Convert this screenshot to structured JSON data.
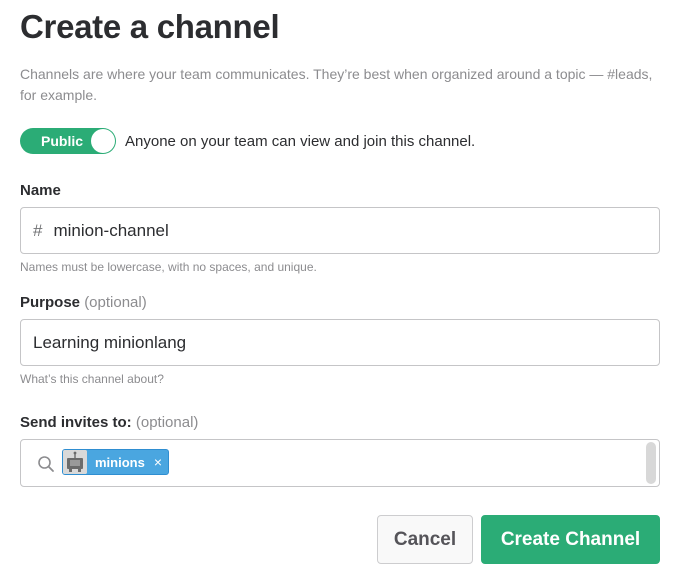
{
  "header": {
    "title": "Create a channel",
    "description": "Channels are where your team communicates. They’re best when organized around a topic — #leads, for example."
  },
  "visibility": {
    "toggle_label": "Public",
    "toggle_on": true,
    "description": "Anyone on your team can view and join this channel.",
    "accent_color": "#2bac76"
  },
  "name_field": {
    "label": "Name",
    "prefix": "#",
    "value": "minion-channel",
    "hint": "Names must be lowercase, with no spaces, and unique."
  },
  "purpose_field": {
    "label": "Purpose",
    "optional": "(optional)",
    "value": "Learning minionlang",
    "hint": "What’s this channel about?"
  },
  "invites_field": {
    "label": "Send invites to:",
    "optional": "(optional)",
    "icon": "search-icon",
    "chips": [
      {
        "label": "minions",
        "remove": "×",
        "color": "#4aa6e0"
      }
    ]
  },
  "actions": {
    "cancel_label": "Cancel",
    "create_label": "Create Channel",
    "create_color": "#2bac76"
  }
}
